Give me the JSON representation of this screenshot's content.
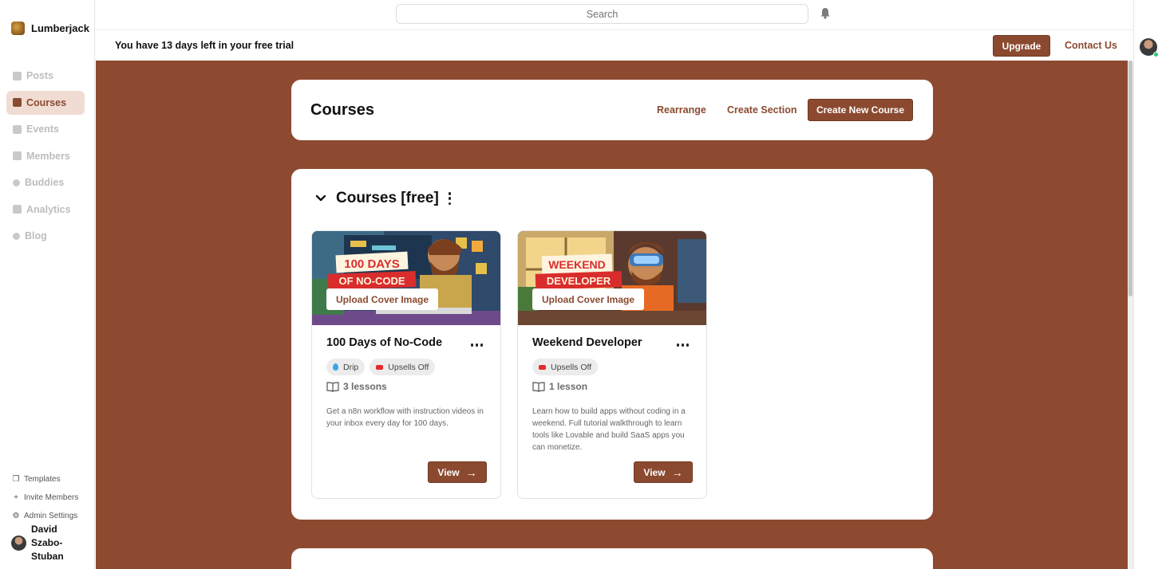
{
  "brand": {
    "name": "Lumberjack"
  },
  "sidebar": {
    "items": [
      {
        "label": "Posts",
        "icon": "pen-icon",
        "active": false
      },
      {
        "label": "Courses",
        "icon": "book-icon",
        "active": true
      },
      {
        "label": "Events",
        "icon": "calendar-icon",
        "active": false
      },
      {
        "label": "Members",
        "icon": "members-icon",
        "active": false
      },
      {
        "label": "Buddies",
        "icon": "buddies-icon",
        "active": false
      },
      {
        "label": "Analytics",
        "icon": "chart-icon",
        "active": false
      },
      {
        "label": "Blog",
        "icon": "link-icon",
        "active": false
      }
    ],
    "footer": [
      {
        "label": "Templates",
        "icon": "templates-icon"
      },
      {
        "label": "Invite Members",
        "icon": "plus-icon"
      },
      {
        "label": "Admin Settings",
        "icon": "gear-icon"
      }
    ],
    "user": {
      "name": "David Szabo-Stuban"
    }
  },
  "topbar": {
    "search_placeholder": "Search"
  },
  "trial": {
    "message": "You have 13 days left in your free trial",
    "upgrade_label": "Upgrade",
    "contact_label": "Contact Us"
  },
  "header": {
    "title": "Courses",
    "rearrange_label": "Rearrange",
    "create_section_label": "Create Section",
    "create_course_label": "Create New Course"
  },
  "section": {
    "title": "Courses [free]",
    "courses": [
      {
        "title": "100 Days of No-Code",
        "upload_label": "Upload Cover Image",
        "badges": [
          "Drip",
          "Upsells Off"
        ],
        "lessons": "3 lessons",
        "description": "Get a n8n workflow with instruction videos in your inbox every day for 100 days.",
        "view_label": "View",
        "cover_text": [
          "100 DAYS",
          "OF NO-CODE"
        ]
      },
      {
        "title": "Weekend Developer",
        "upload_label": "Upload Cover Image",
        "badges": [
          "Upsells Off"
        ],
        "lessons": "1 lesson",
        "description": "Learn how to build apps without coding in a weekend. Full tutorial walkthrough to learn tools like Lovable and build SaaS apps you can monetize.",
        "view_label": "View",
        "cover_text": [
          "WEEKEND",
          "DEVELOPER"
        ]
      }
    ]
  },
  "colors": {
    "accent": "#8b4a30",
    "main_bg": "#8d4a30",
    "active_nav_bg": "#f0dcd3"
  }
}
